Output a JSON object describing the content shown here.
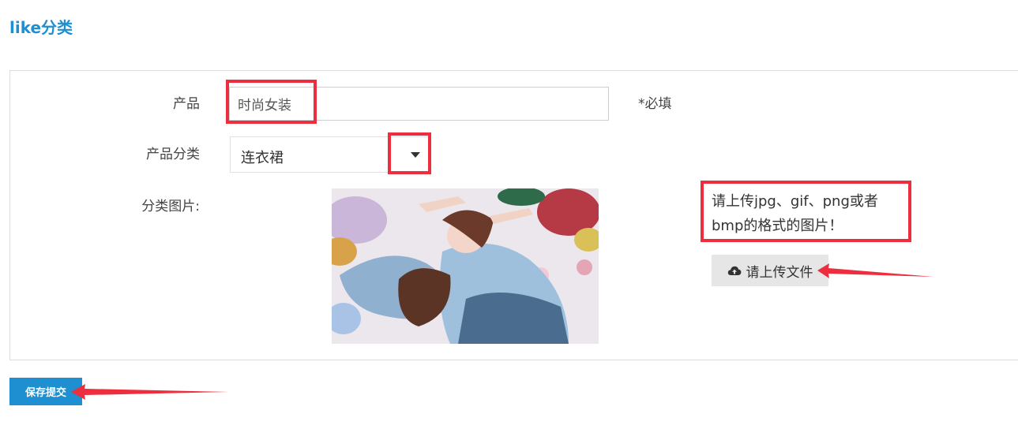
{
  "page": {
    "title": "like分类"
  },
  "form": {
    "product_label": "产品",
    "product_value": "时尚女装",
    "required_note": "*必填",
    "category_label": "产品分类",
    "category_selected": "连衣裙",
    "image_label": "分类图片:",
    "upload_hint": "请上传jpg、gif、png或者bmp的格式的图片！",
    "upload_button": "请上传文件",
    "submit_button": "保存提交"
  },
  "colors": {
    "accent": "#1e8fd0",
    "annotation": "#ec2e3e"
  },
  "icons": {
    "upload": "cloud-upload-icon",
    "select": "caret-down-icon"
  }
}
